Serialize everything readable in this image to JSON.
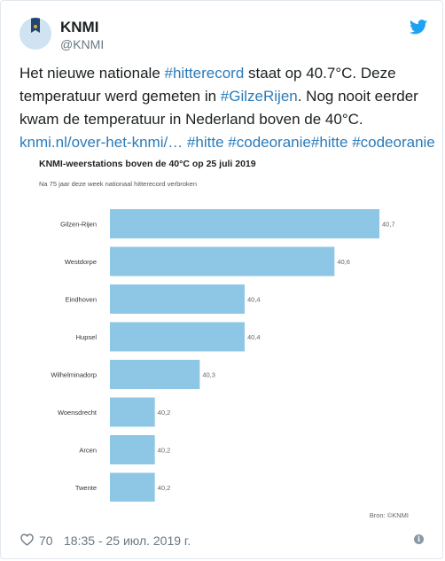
{
  "author": {
    "name": "KNMI",
    "handle": "@KNMI"
  },
  "tweet": {
    "lines": [
      [
        {
          "t": "Het nieuwe nationale "
        },
        {
          "t": "#hitterecord",
          "link": true
        },
        {
          "t": " staat op 40.7°C. Deze"
        }
      ],
      [
        {
          "t": "temperatuur werd gemeten in "
        },
        {
          "t": "#GilzeRijen",
          "link": true
        },
        {
          "t": ". Nog nooit eerder"
        }
      ],
      [
        {
          "t": "kwam de temperatuur in Nederland boven de 40°C."
        }
      ],
      [
        {
          "t": "knmi.nl/over-het-knmi/…",
          "link": true
        },
        {
          "t": " "
        },
        {
          "t": "#hitte",
          "link": true
        },
        {
          "t": " "
        },
        {
          "t": "#codeoranje",
          "link": true
        },
        {
          "t": "#hitte",
          "link": true
        },
        {
          "t": " "
        },
        {
          "t": "#codeoranje",
          "link": true
        }
      ]
    ]
  },
  "chart": {
    "title": "KNMI-weerstations boven de 40°C op 25 juli 2019",
    "subtitle": "Na 75 jaar deze week nationaal hitterecord verbroken",
    "source": "Bron: ©KNMI"
  },
  "chart_data": {
    "type": "bar",
    "orientation": "horizontal",
    "title": "KNMI-weerstations boven de 40°C op 25 juli 2019",
    "subtitle": "Na 75 jaar deze week nationaal hitterecord verbroken",
    "categories": [
      "Gilzen-Rijen",
      "Westdorpe",
      "Eindhoven",
      "Hupsel",
      "Wilhelminadorp",
      "Woensdrecht",
      "Arcen",
      "Twente"
    ],
    "values": [
      40.7,
      40.6,
      40.4,
      40.4,
      40.3,
      40.2,
      40.2,
      40.2
    ],
    "value_labels": [
      "40,7",
      "40,6",
      "40,4",
      "40,4",
      "40,3",
      "40,2",
      "40,2",
      "40,2"
    ],
    "xlim": [
      40.1,
      40.7
    ],
    "bar_color": "#8ec7e6",
    "grid": false,
    "source": "Bron: ©KNMI"
  },
  "footer": {
    "likes": "70",
    "datetime": "18:35 - 25 июл. 2019 г."
  },
  "colors": {
    "link": "#2b7bb9",
    "twitter": "#1da1f2",
    "muted": "#697882"
  },
  "icons": [
    "twitter-bird-icon",
    "heart-icon",
    "info-icon"
  ]
}
